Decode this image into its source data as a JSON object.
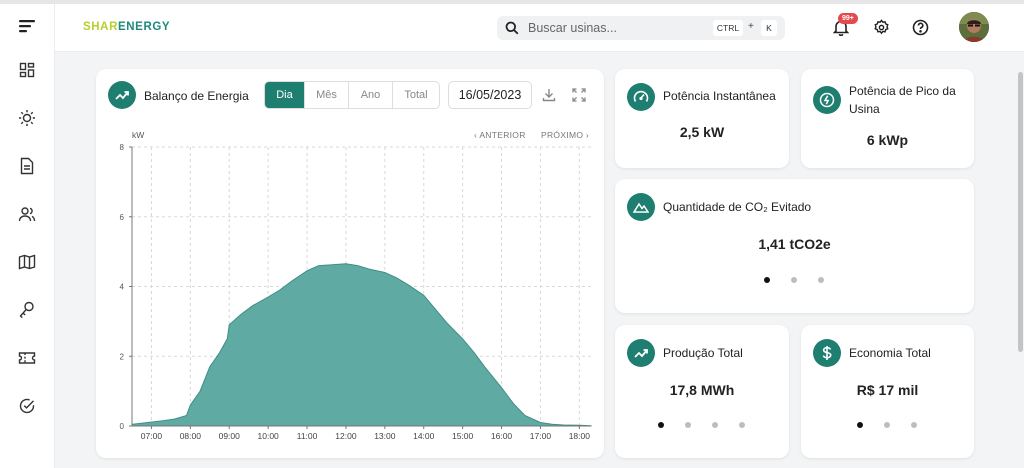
{
  "brand": {
    "part1": "SHAR",
    "part2": "ENERGY"
  },
  "search": {
    "placeholder": "Buscar usinas...",
    "key1": "CTRL",
    "plus": "+",
    "key2": "K"
  },
  "notifications": {
    "badge": "99+"
  },
  "energy_card": {
    "title": "Balanço de Energia",
    "tabs": [
      "Dia",
      "Mês",
      "Ano",
      "Total"
    ],
    "active_tab": "Dia",
    "date": "16/05/2023",
    "prev_label": "‹ ANTERIOR",
    "next_label": "PRÓXIMO ›",
    "unit": "kW"
  },
  "cards": {
    "power": {
      "title": "Potência Instantânea",
      "value": "2,5 kW"
    },
    "peak": {
      "title_line1": "Potência de Pico da",
      "title_line2": "Usina",
      "value": "6 kWp"
    },
    "co2": {
      "title": "Quantidade de CO₂ Evitado",
      "value": "1,41 tCO2e"
    },
    "production": {
      "title": "Produção Total",
      "value": "17,8 MWh"
    },
    "savings": {
      "title": "Economia Total",
      "value": "R$ 17 mil"
    }
  },
  "colors": {
    "accent": "#1e7e6f",
    "area": "#5faaa2"
  },
  "chart_data": {
    "type": "area",
    "ylabel": "kW",
    "ylim": [
      0,
      8
    ],
    "yticks": [
      0,
      2,
      4,
      6,
      8
    ],
    "xlim": [
      6.5,
      18.3
    ],
    "xticks": [
      "07:00",
      "08:00",
      "09:00",
      "10:00",
      "11:00",
      "12:00",
      "13:00",
      "14:00",
      "15:00",
      "16:00",
      "17:00",
      "18:00"
    ],
    "grid": true,
    "series": [
      {
        "x": [
          6.5,
          6.9,
          7.3,
          7.6,
          7.9,
          8.0,
          8.25,
          8.5,
          8.75,
          8.95,
          9.0,
          9.3,
          9.6,
          10.0,
          10.3,
          10.6,
          11.0,
          11.3,
          11.6,
          12.0,
          12.3,
          12.6,
          13.0,
          13.3,
          13.6,
          14.0,
          14.3,
          14.6,
          15.0,
          15.3,
          15.6,
          16.0,
          16.3,
          16.6,
          17.0,
          17.3,
          17.6,
          18.0,
          18.3
        ],
        "y": [
          0.05,
          0.1,
          0.15,
          0.2,
          0.3,
          0.6,
          1.0,
          1.7,
          2.1,
          2.5,
          2.9,
          3.2,
          3.45,
          3.7,
          3.9,
          4.15,
          4.45,
          4.6,
          4.62,
          4.65,
          4.6,
          4.5,
          4.4,
          4.25,
          4.05,
          3.75,
          3.35,
          2.95,
          2.5,
          2.1,
          1.65,
          1.1,
          0.65,
          0.3,
          0.1,
          0.05,
          0.03,
          0.02,
          0.01
        ]
      }
    ]
  }
}
